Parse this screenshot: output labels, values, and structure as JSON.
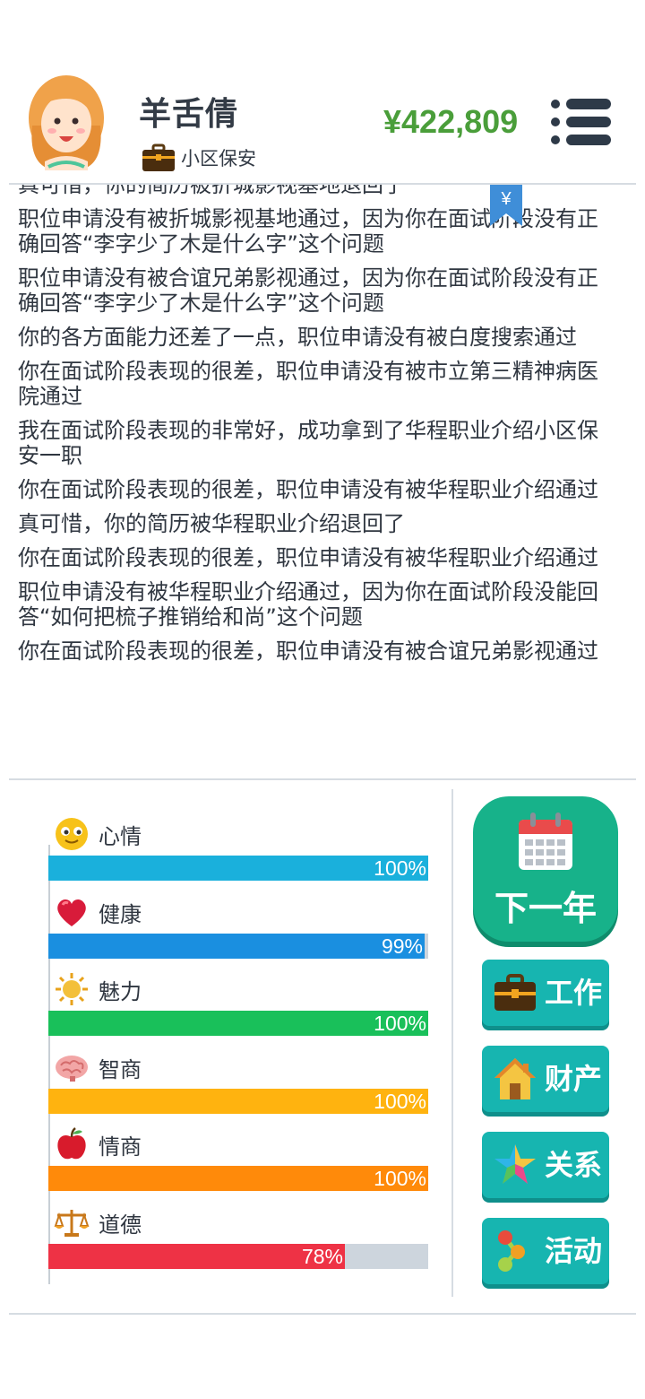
{
  "player": {
    "name": "羊舌倩",
    "job": "小区保安",
    "money": "¥422,809"
  },
  "log_flag": "¥",
  "log": [
    "真可惜，你的简历被折城影视基地退回了",
    "职位申请没有被折城影视基地通过，因为你在面试阶段没有正确回答“李字少了木是什么字”这个问题",
    "职位申请没有被合谊兄弟影视通过，因为你在面试阶段没有正确回答“李字少了木是什么字”这个问题",
    "你的各方面能力还差了一点，职位申请没有被白度搜索通过",
    "你在面试阶段表现的很差，职位申请没有被市立第三精神病医院通过",
    "我在面试阶段表现的非常好，成功拿到了华程职业介绍小区保安一职",
    "你在面试阶段表现的很差，职位申请没有被华程职业介绍通过",
    "真可惜，你的简历被华程职业介绍退回了",
    "你在面试阶段表现的很差，职位申请没有被华程职业介绍通过",
    "职位申请没有被华程职业介绍通过，因为你在面试阶段没能回答“如何把梳子推销给和尚”这个问题",
    "你在面试阶段表现的很差，职位申请没有被合谊兄弟影视通过"
  ],
  "stats": [
    {
      "label": "心情",
      "percent": "100%",
      "value": 100,
      "color": "#1ab0dc",
      "icon": "smiley-icon"
    },
    {
      "label": "健康",
      "percent": "99%",
      "value": 99,
      "color": "#1a8fe0",
      "icon": "heart-icon"
    },
    {
      "label": "魅力",
      "percent": "100%",
      "value": 100,
      "color": "#19c05a",
      "icon": "sun-icon"
    },
    {
      "label": "智商",
      "percent": "100%",
      "value": 100,
      "color": "#ffb30f",
      "icon": "brain-icon"
    },
    {
      "label": "情商",
      "percent": "100%",
      "value": 100,
      "color": "#ff8a0a",
      "icon": "apple-icon"
    },
    {
      "label": "道德",
      "percent": "78%",
      "value": 78,
      "color": "#ee3245",
      "icon": "scales-icon"
    }
  ],
  "actions": {
    "next_year": "下一年",
    "work": "工作",
    "property": "财产",
    "relations": "关系",
    "activities": "活动"
  }
}
